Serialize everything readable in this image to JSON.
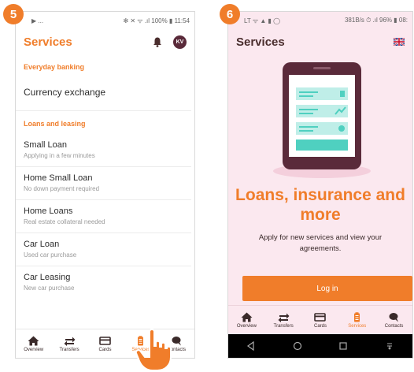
{
  "steps": {
    "left": "5",
    "right": "6"
  },
  "left": {
    "status": {
      "left": "▶ ...",
      "right": "✻ ✕ ᯤ .ıl 100% ▮ 11:54"
    },
    "title": "Services",
    "avatar_initials": "KV",
    "sections": [
      {
        "header": "Everyday banking",
        "items": [
          {
            "title": "Currency exchange",
            "subtitle": ""
          }
        ]
      },
      {
        "header": "Loans and leasing",
        "items": [
          {
            "title": "Small Loan",
            "subtitle": "Applying in a few minutes"
          },
          {
            "title": "Home Small Loan",
            "subtitle": "No down payment required"
          },
          {
            "title": "Home Loans",
            "subtitle": "Real estate collateral needed"
          },
          {
            "title": "Car Loan",
            "subtitle": "Used car purchase"
          },
          {
            "title": "Car Leasing",
            "subtitle": "New car purchase"
          }
        ]
      }
    ],
    "nav": [
      {
        "label": "Overview",
        "icon": "home-icon"
      },
      {
        "label": "Transfers",
        "icon": "transfer-icon"
      },
      {
        "label": "Cards",
        "icon": "card-icon"
      },
      {
        "label": "Services",
        "icon": "services-icon",
        "active": true
      },
      {
        "label": "Contacts",
        "icon": "chat-icon"
      }
    ]
  },
  "right": {
    "status": {
      "left": "LT ᯤ ▲ ▮ ◯",
      "right": "381B/s ⏱ .ıl 96% ▮ 08:"
    },
    "title": "Services",
    "promo_title": "Loans, insurance and more",
    "promo_text": "Apply for new services and view your agreements.",
    "login_label": "Log in",
    "nav": [
      {
        "label": "Overview",
        "icon": "home-icon"
      },
      {
        "label": "Transfers",
        "icon": "transfer-icon"
      },
      {
        "label": "Cards",
        "icon": "card-icon"
      },
      {
        "label": "Services",
        "icon": "services-icon",
        "active": true
      },
      {
        "label": "Contacts",
        "icon": "chat-icon"
      }
    ]
  },
  "colors": {
    "accent": "#f07d2a",
    "dark": "#5a2a3a",
    "teal": "#4fd0c0",
    "pink_bg": "#fbe8ef"
  }
}
